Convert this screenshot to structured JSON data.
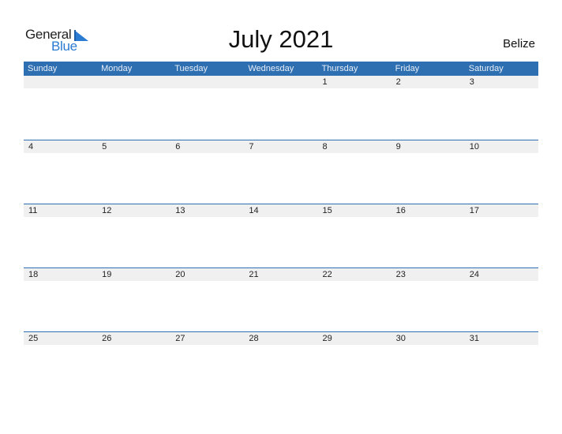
{
  "logo": {
    "line1": "General",
    "line2": "Blue"
  },
  "title": "July 2021",
  "country": "Belize",
  "colors": {
    "header_bg": "#2e6fb2",
    "row_band": "#f0f0f0",
    "accent": "#2a7bd1"
  },
  "weekdays": [
    "Sunday",
    "Monday",
    "Tuesday",
    "Wednesday",
    "Thursday",
    "Friday",
    "Saturday"
  ],
  "weeks": [
    [
      "",
      "",
      "",
      "",
      "1",
      "2",
      "3"
    ],
    [
      "4",
      "5",
      "6",
      "7",
      "8",
      "9",
      "10"
    ],
    [
      "11",
      "12",
      "13",
      "14",
      "15",
      "16",
      "17"
    ],
    [
      "18",
      "19",
      "20",
      "21",
      "22",
      "23",
      "24"
    ],
    [
      "25",
      "26",
      "27",
      "28",
      "29",
      "30",
      "31"
    ]
  ]
}
